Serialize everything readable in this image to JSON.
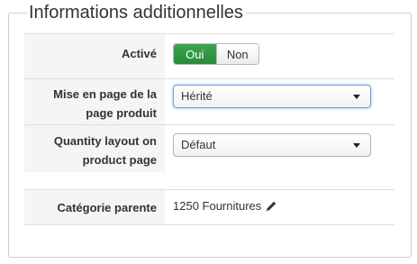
{
  "section": {
    "legend": "Informations additionnelles"
  },
  "fields": {
    "active": {
      "label": "Activé",
      "yes_label": "Oui",
      "no_label": "Non",
      "selected": "Oui"
    },
    "page_layout": {
      "label": "Mise en page de la page produit",
      "value": "Hérité"
    },
    "quantity_layout": {
      "label": "Quantity layout on product page",
      "value": "Défaut"
    },
    "parent_category": {
      "label": "Catégorie parente",
      "value": "1250 Fournitures",
      "icon": "pencil-icon"
    }
  },
  "colors": {
    "toggle_active": "#2f9a44",
    "focus_border": "#6fa3d8"
  }
}
